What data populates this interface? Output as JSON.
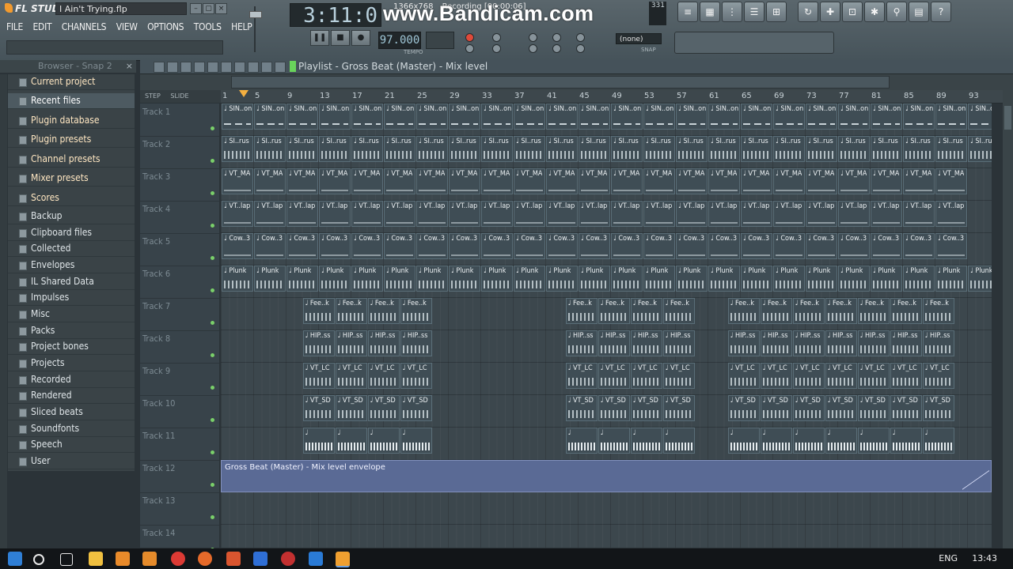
{
  "app": {
    "title_file": "I Ain't Trying.flp",
    "menu": [
      "FILE",
      "EDIT",
      "CHANNELS",
      "VIEW",
      "OPTIONS",
      "TOOLS",
      "HELP"
    ],
    "time_display": "3:11:0",
    "watermark": "www.Bandicam.com",
    "recording_bar": [
      "1366x768",
      "Recording [00:00:06]"
    ],
    "cpu": "331",
    "tempo": "97.000",
    "tempo_label": "TEMPO",
    "snap_value": "(none)",
    "snap_label": "SNAP"
  },
  "browser": {
    "header": "Browser - Snap 2",
    "items": [
      "Current project",
      "Recent files",
      "Plugin database",
      "Plugin presets",
      "Channel presets",
      "Mixer presets",
      "Scores",
      "Backup",
      "Clipboard files",
      "Collected",
      "Envelopes",
      "IL Shared Data",
      "Impulses",
      "Misc",
      "Packs",
      "Project bones",
      "Projects",
      "Recorded",
      "Rendered",
      "Sliced beats",
      "Soundfonts",
      "Speech",
      "User"
    ]
  },
  "playlist": {
    "title": "Playlist - Gross Beat (Master) - Mix level",
    "ruler_left": [
      "STEP",
      "SLIDE"
    ],
    "ruler": [
      "1",
      "5",
      "9",
      "13",
      "17",
      "21",
      "25",
      "29",
      "33",
      "37",
      "41",
      "45",
      "49",
      "53",
      "57",
      "61",
      "65",
      "69",
      "73",
      "77",
      "81",
      "85",
      "89",
      "93"
    ],
    "tracks": [
      "Track 1",
      "Track 2",
      "Track 3",
      "Track 4",
      "Track 5",
      "Track 6",
      "Track 7",
      "Track 8",
      "Track 9",
      "Track 10",
      "Track 11",
      "Track 12",
      "Track 13",
      "Track 14"
    ],
    "clip_labels": {
      "t1": "SIN..on",
      "t2": "SI..rus",
      "t3": "VT_MA",
      "t4": "VT..lap",
      "t5": "Cow..3",
      "t6": "Plunk",
      "t7": "Fee..k",
      "t8": "HIP..ss",
      "t9": "VT_LC",
      "t10": "VT_SD"
    },
    "envelope_label": "Gross Beat (Master) - Mix level envelope"
  },
  "taskbar": {
    "language": "ENG",
    "clock": "13:43"
  }
}
